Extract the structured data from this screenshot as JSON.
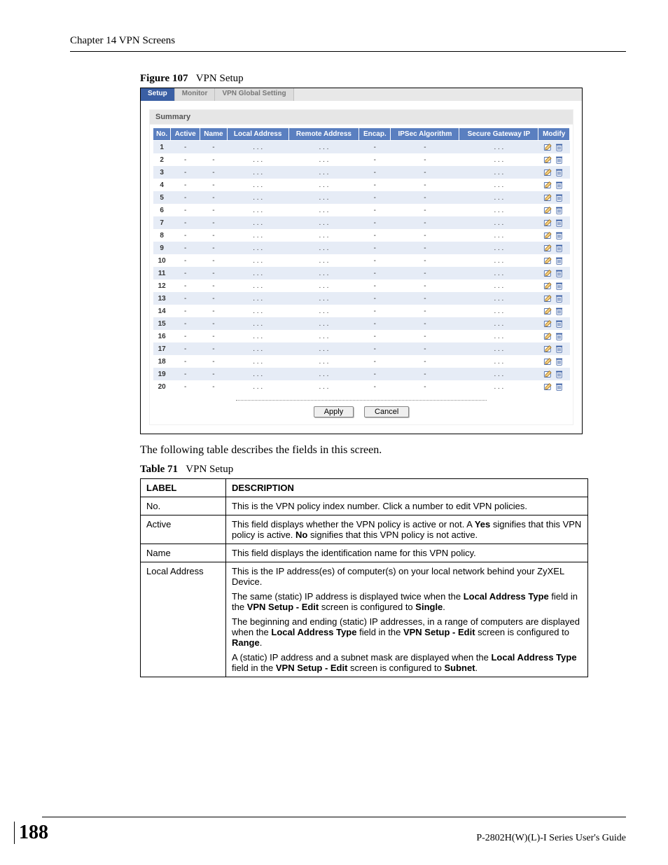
{
  "chapter_header": "Chapter 14 VPN Screens",
  "figure": {
    "label": "Figure 107",
    "title": "VPN Setup"
  },
  "router_ui": {
    "tabs": [
      "Setup",
      "Monitor",
      "VPN Global Setting"
    ],
    "panel_title": "Summary",
    "columns": [
      "No.",
      "Active",
      "Name",
      "Local Address",
      "Remote Address",
      "Encap.",
      "IPSec Algorithm",
      "Secure Gateway IP",
      "Modify"
    ],
    "rows": [
      {
        "no": "1",
        "active": "-",
        "name": "-",
        "local": ". . .",
        "remote": ". . .",
        "encap": "-",
        "ipsec": "-",
        "sgw": ". . ."
      },
      {
        "no": "2",
        "active": "-",
        "name": "-",
        "local": ". . .",
        "remote": ". . .",
        "encap": "-",
        "ipsec": "-",
        "sgw": ". . ."
      },
      {
        "no": "3",
        "active": "-",
        "name": "-",
        "local": ". . .",
        "remote": ". . .",
        "encap": "-",
        "ipsec": "-",
        "sgw": ". . ."
      },
      {
        "no": "4",
        "active": "-",
        "name": "-",
        "local": ". . .",
        "remote": ". . .",
        "encap": "-",
        "ipsec": "-",
        "sgw": ". . ."
      },
      {
        "no": "5",
        "active": "-",
        "name": "-",
        "local": ". . .",
        "remote": ". . .",
        "encap": "-",
        "ipsec": "-",
        "sgw": ". . ."
      },
      {
        "no": "6",
        "active": "-",
        "name": "-",
        "local": ". . .",
        "remote": ". . .",
        "encap": "-",
        "ipsec": "-",
        "sgw": ". . ."
      },
      {
        "no": "7",
        "active": "-",
        "name": "-",
        "local": ". . .",
        "remote": ". . .",
        "encap": "-",
        "ipsec": "-",
        "sgw": ". . ."
      },
      {
        "no": "8",
        "active": "-",
        "name": "-",
        "local": ". . .",
        "remote": ". . .",
        "encap": "-",
        "ipsec": "-",
        "sgw": ". . ."
      },
      {
        "no": "9",
        "active": "-",
        "name": "-",
        "local": ". . .",
        "remote": ". . .",
        "encap": "-",
        "ipsec": "-",
        "sgw": ". . ."
      },
      {
        "no": "10",
        "active": "-",
        "name": "-",
        "local": ". . .",
        "remote": ". . .",
        "encap": "-",
        "ipsec": "-",
        "sgw": ". . ."
      },
      {
        "no": "11",
        "active": "-",
        "name": "-",
        "local": ". . .",
        "remote": ". . .",
        "encap": "-",
        "ipsec": "-",
        "sgw": ". . ."
      },
      {
        "no": "12",
        "active": "-",
        "name": "-",
        "local": ". . .",
        "remote": ". . .",
        "encap": "-",
        "ipsec": "-",
        "sgw": ". . ."
      },
      {
        "no": "13",
        "active": "-",
        "name": "-",
        "local": ". . .",
        "remote": ". . .",
        "encap": "-",
        "ipsec": "-",
        "sgw": ". . ."
      },
      {
        "no": "14",
        "active": "-",
        "name": "-",
        "local": ". . .",
        "remote": ". . .",
        "encap": "-",
        "ipsec": "-",
        "sgw": ". . ."
      },
      {
        "no": "15",
        "active": "-",
        "name": "-",
        "local": ". . .",
        "remote": ". . .",
        "encap": "-",
        "ipsec": "-",
        "sgw": ". . ."
      },
      {
        "no": "16",
        "active": "-",
        "name": "-",
        "local": ". . .",
        "remote": ". . .",
        "encap": "-",
        "ipsec": "-",
        "sgw": ". . ."
      },
      {
        "no": "17",
        "active": "-",
        "name": "-",
        "local": ". . .",
        "remote": ". . .",
        "encap": "-",
        "ipsec": "-",
        "sgw": ". . ."
      },
      {
        "no": "18",
        "active": "-",
        "name": "-",
        "local": ". . .",
        "remote": ". . .",
        "encap": "-",
        "ipsec": "-",
        "sgw": ". . ."
      },
      {
        "no": "19",
        "active": "-",
        "name": "-",
        "local": ". . .",
        "remote": ". . .",
        "encap": "-",
        "ipsec": "-",
        "sgw": ". . ."
      },
      {
        "no": "20",
        "active": "-",
        "name": "-",
        "local": ". . .",
        "remote": ". . .",
        "encap": "-",
        "ipsec": "-",
        "sgw": ". . ."
      }
    ],
    "buttons": {
      "apply": "Apply",
      "cancel": "Cancel"
    }
  },
  "body_text": "The following table describes the fields in this screen.",
  "table": {
    "label": "Table 71",
    "title": "VPN Setup",
    "head": {
      "label": "LABEL",
      "description": "DESCRIPTION"
    },
    "rows": {
      "no": {
        "label": "No.",
        "d0": "This is the VPN policy index number. Click a number to edit VPN policies."
      },
      "active": {
        "label": "Active",
        "d0a": "This field displays whether the VPN policy is active or not. A ",
        "d0b": "Yes",
        "d0c": " signifies that this VPN policy is active. ",
        "d0d": "No",
        "d0e": " signifies that this VPN policy is not active."
      },
      "name": {
        "label": "Name",
        "d0": "This field displays the identification name for this VPN policy."
      },
      "local": {
        "label": "Local Address",
        "p0": "This is the IP address(es) of computer(s) on your local network behind your ZyXEL Device.",
        "p1a": "The same (static) IP address is displayed twice when the ",
        "p1b": "Local Address Type",
        "p1c": " field in the ",
        "p1d": "VPN Setup - Edit",
        "p1e": " screen is configured to ",
        "p1f": "Single",
        "p1g": ".",
        "p2a": "The beginning and ending (static) IP addresses, in a range of computers are displayed when the ",
        "p2b": "Local Address Type",
        "p2c": " field in the ",
        "p2d": "VPN Setup - Edit",
        "p2e": " screen is configured to ",
        "p2f": "Range",
        "p2g": ".",
        "p3a": "A (static) IP address and a subnet mask are displayed when the ",
        "p3b": "Local Address Type",
        "p3c": " field in the ",
        "p3d": "VPN Setup - Edit",
        "p3e": " screen is configured to ",
        "p3f": "Subnet",
        "p3g": "."
      }
    }
  },
  "footer": {
    "page": "188",
    "guide": "P-2802H(W)(L)-I Series User's Guide"
  }
}
